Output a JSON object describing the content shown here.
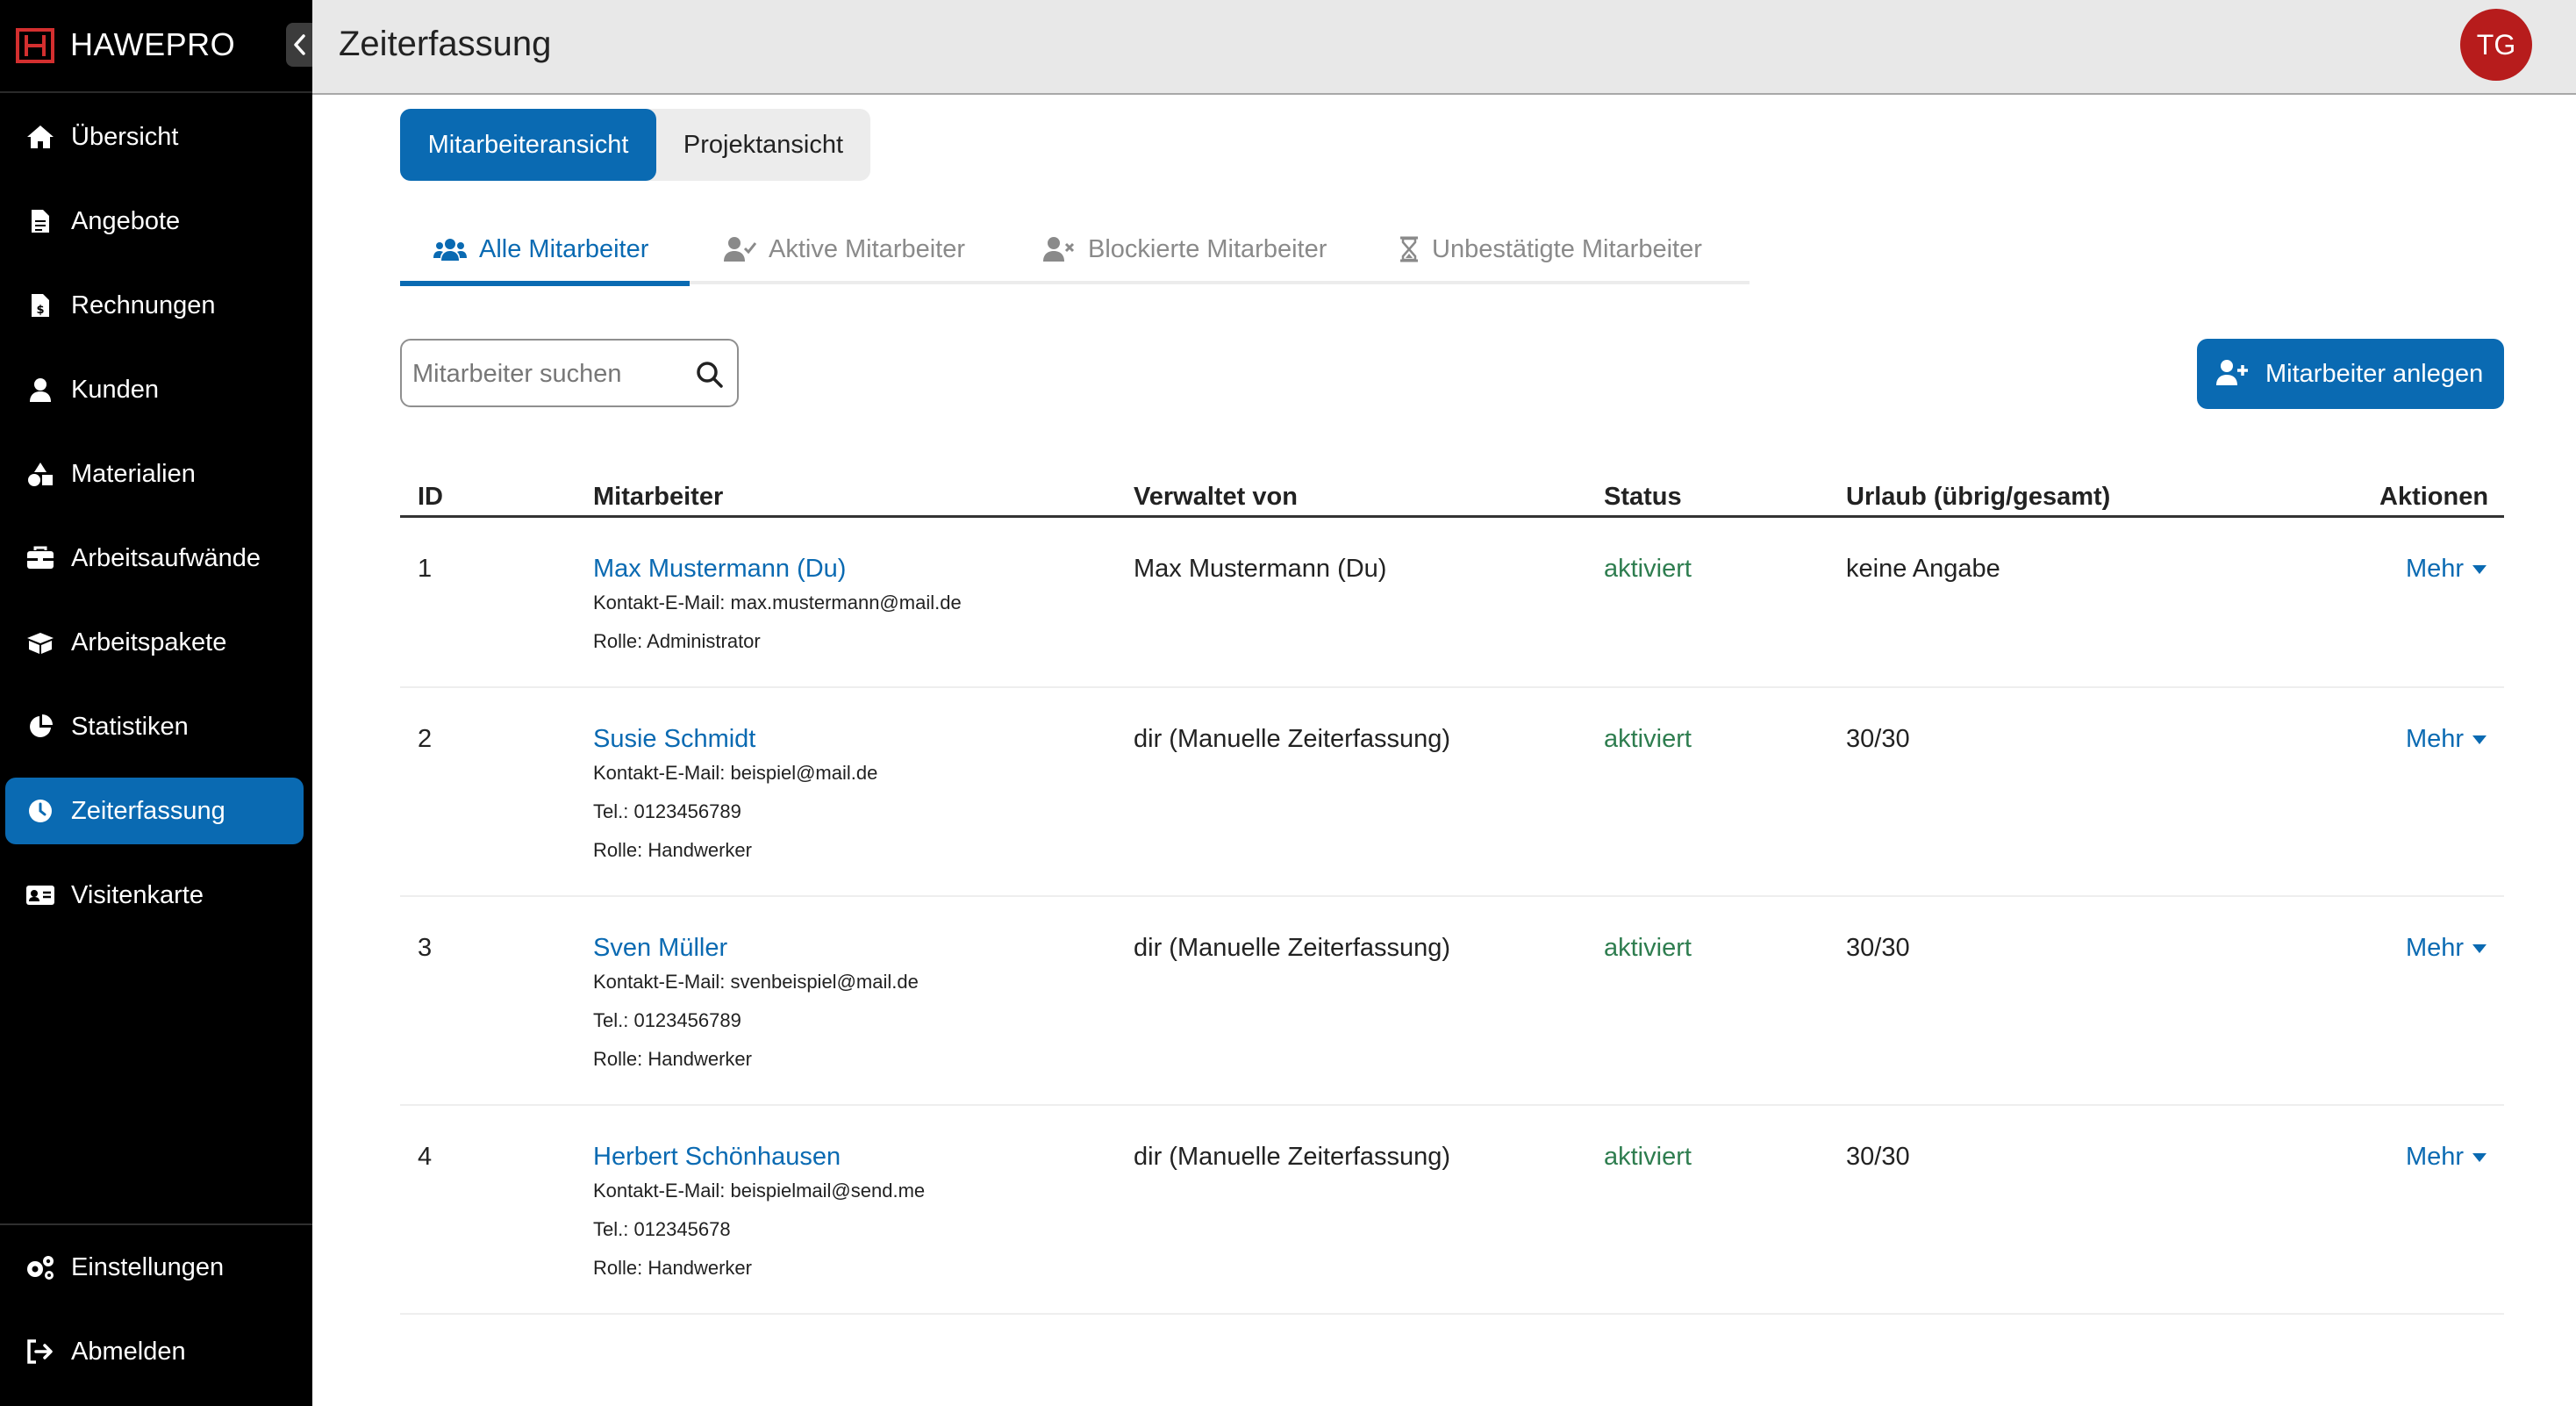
{
  "brand": {
    "name": "HAWEPRO"
  },
  "sidebar": {
    "items": [
      {
        "label": "Übersicht",
        "icon": "home-icon"
      },
      {
        "label": "Angebote",
        "icon": "document-icon"
      },
      {
        "label": "Rechnungen",
        "icon": "invoice-icon"
      },
      {
        "label": "Kunden",
        "icon": "user-icon"
      },
      {
        "label": "Materialien",
        "icon": "shapes-icon"
      },
      {
        "label": "Arbeitsaufwände",
        "icon": "toolbox-icon"
      },
      {
        "label": "Arbeitspakete",
        "icon": "boxes-icon"
      },
      {
        "label": "Statistiken",
        "icon": "pie-chart-icon"
      },
      {
        "label": "Zeiterfassung",
        "icon": "clock-icon",
        "active": true
      },
      {
        "label": "Visitenkarte",
        "icon": "id-card-icon"
      }
    ],
    "bottom_items": [
      {
        "label": "Einstellungen",
        "icon": "gears-icon"
      },
      {
        "label": "Abmelden",
        "icon": "logout-icon"
      }
    ]
  },
  "header": {
    "title": "Zeiterfassung",
    "avatar_initials": "TG"
  },
  "view_toggle": {
    "active": "Mitarbeiteransicht",
    "inactive": "Projektansicht"
  },
  "tabs": [
    {
      "label": "Alle Mitarbeiter",
      "active": true
    },
    {
      "label": "Aktive Mitarbeiter"
    },
    {
      "label": "Blockierte Mitarbeiter"
    },
    {
      "label": "Unbestätigte Mitarbeiter"
    }
  ],
  "search": {
    "placeholder": "Mitarbeiter suchen"
  },
  "add_button": {
    "label": "Mitarbeiter anlegen"
  },
  "table": {
    "columns": [
      "ID",
      "Mitarbeiter",
      "Verwaltet von",
      "Status",
      "Urlaub (übrig/gesamt)",
      "Aktionen"
    ],
    "rows": [
      {
        "id": "1",
        "name": "Max Mustermann (Du)",
        "details": [
          "Kontakt-E-Mail: max.mustermann@mail.de",
          "Rolle: Administrator"
        ],
        "managed_by": "Max Mustermann (Du)",
        "status": "aktiviert",
        "vacation": "keine Angabe",
        "action": "Mehr"
      },
      {
        "id": "2",
        "name": "Susie Schmidt",
        "details": [
          "Kontakt-E-Mail: beispiel@mail.de",
          "Tel.: 0123456789",
          "Rolle: Handwerker"
        ],
        "managed_by": "dir (Manuelle Zeiterfassung)",
        "status": "aktiviert",
        "vacation": "30/30",
        "action": "Mehr"
      },
      {
        "id": "3",
        "name": "Sven Müller",
        "details": [
          "Kontakt-E-Mail: svenbeispiel@mail.de",
          "Tel.: 0123456789",
          "Rolle: Handwerker"
        ],
        "managed_by": "dir (Manuelle Zeiterfassung)",
        "status": "aktiviert",
        "vacation": "30/30",
        "action": "Mehr"
      },
      {
        "id": "4",
        "name": "Herbert Schönhausen",
        "details": [
          "Kontakt-E-Mail: beispielmail@send.me",
          "Tel.: 012345678",
          "Rolle: Handwerker"
        ],
        "managed_by": "dir (Manuelle Zeiterfassung)",
        "status": "aktiviert",
        "vacation": "30/30",
        "action": "Mehr"
      }
    ]
  },
  "colors": {
    "accent": "#0a6ab2",
    "status_active": "#2e7d4f",
    "avatar": "#b71c1c",
    "sidebar_bg": "#000000"
  }
}
